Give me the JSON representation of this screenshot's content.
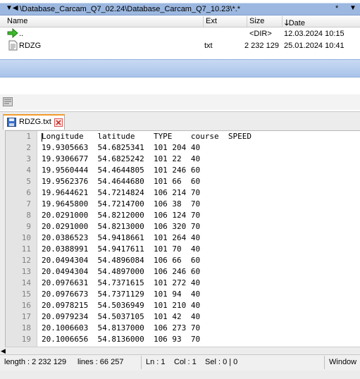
{
  "file_panel": {
    "path": "\\Database_Carcam_Q7_02.24\\Database_Carcam_Q7_10.23\\*.*",
    "star": "*",
    "columns": {
      "name": "Name",
      "ext": "Ext",
      "size": "Size",
      "date": "Date"
    },
    "files": [
      {
        "name": "..",
        "ext": "",
        "size": "<DIR>",
        "date": "12.03.2024 10:15",
        "icon": "up-arrow-icon"
      },
      {
        "name": "RDZG",
        "ext": "txt",
        "size": "2 232 129",
        "date": "25.01.2024 10:41",
        "icon": "text-file-icon"
      }
    ]
  },
  "editor": {
    "tab": {
      "name": "RDZG.txt"
    },
    "lines": [
      {
        "n": "1",
        "text": "Longitude   latitude    TYPE    course  SPEED"
      },
      {
        "n": "2",
        "text": "19.9305663  54.6825341  101 204 40"
      },
      {
        "n": "3",
        "text": "19.9306677  54.6825242  101 22  40"
      },
      {
        "n": "4",
        "text": "19.9560444  54.4644805  101 246 60"
      },
      {
        "n": "5",
        "text": "19.9562376  54.4644680  101 66  60"
      },
      {
        "n": "6",
        "text": "19.9644621  54.7214824  106 214 70"
      },
      {
        "n": "7",
        "text": "19.9645800  54.7214700  106 38  70"
      },
      {
        "n": "8",
        "text": "20.0291000  54.8212000  106 124 70"
      },
      {
        "n": "9",
        "text": "20.0291000  54.8213000  106 320 70"
      },
      {
        "n": "10",
        "text": "20.0386523  54.9418661  101 264 40"
      },
      {
        "n": "11",
        "text": "20.0388991  54.9417611  101 70  40"
      },
      {
        "n": "12",
        "text": "20.0494304  54.4896084  106 66  60"
      },
      {
        "n": "13",
        "text": "20.0494304  54.4897000  106 246 60"
      },
      {
        "n": "14",
        "text": "20.0976631  54.7371615  101 272 40"
      },
      {
        "n": "15",
        "text": "20.0976673  54.7371129  101 94  40"
      },
      {
        "n": "16",
        "text": "20.0978215  54.5036949  101 210 40"
      },
      {
        "n": "17",
        "text": "20.0979234  54.5037105  101 42  40"
      },
      {
        "n": "18",
        "text": "20.1006603  54.8137000  106 273 70"
      },
      {
        "n": "19",
        "text": "20.1006656  54.8136000  106 93  70"
      }
    ]
  },
  "status": {
    "length": "length : 2 232 129",
    "lines": "lines : 66 257",
    "ln": "Ln : 1",
    "col": "Col : 1",
    "sel": "Sel : 0 | 0",
    "eol": "Window"
  },
  "colors": {
    "path_bar": "#9cb8e0",
    "tab_accent": "#f39a2a",
    "close_red": "#d9534f"
  }
}
